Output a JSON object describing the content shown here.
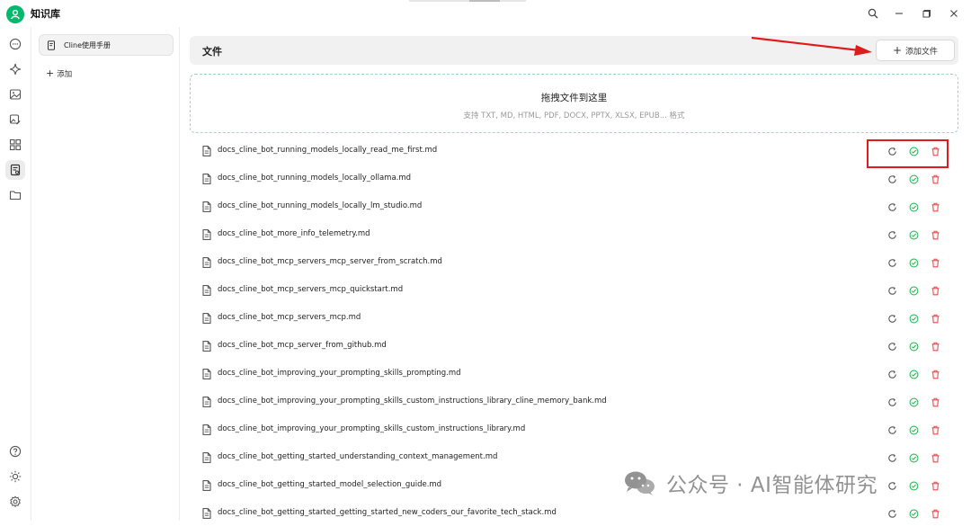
{
  "app": {
    "title": "知识库"
  },
  "knowledge_bases": {
    "items": [
      {
        "label": "Cline使用手册"
      }
    ],
    "add_label": "添加"
  },
  "files": {
    "title": "文件",
    "add_button_label": "添加文件",
    "dropzone_title": "拖拽文件到这里",
    "dropzone_subtitle": "支持 TXT, MD, HTML, PDF, DOCX, PPTX, XLSX, EPUB... 格式",
    "items": [
      {
        "name": "docs_cline_bot_running_models_locally_read_me_first.md"
      },
      {
        "name": "docs_cline_bot_running_models_locally_ollama.md"
      },
      {
        "name": "docs_cline_bot_running_models_locally_lm_studio.md"
      },
      {
        "name": "docs_cline_bot_more_info_telemetry.md"
      },
      {
        "name": "docs_cline_bot_mcp_servers_mcp_server_from_scratch.md"
      },
      {
        "name": "docs_cline_bot_mcp_servers_mcp_quickstart.md"
      },
      {
        "name": "docs_cline_bot_mcp_servers_mcp.md"
      },
      {
        "name": "docs_cline_bot_mcp_server_from_github.md"
      },
      {
        "name": "docs_cline_bot_improving_your_prompting_skills_prompting.md"
      },
      {
        "name": "docs_cline_bot_improving_your_prompting_skills_custom_instructions_library_cline_memory_bank.md"
      },
      {
        "name": "docs_cline_bot_improving_your_prompting_skills_custom_instructions_library.md"
      },
      {
        "name": "docs_cline_bot_getting_started_understanding_context_management.md"
      },
      {
        "name": "docs_cline_bot_getting_started_model_selection_guide.md"
      },
      {
        "name": "docs_cline_bot_getting_started_getting_started_new_coders_our_favorite_tech_stack.md"
      }
    ]
  },
  "watermark": {
    "text": "公众号 · AI智能体研究"
  },
  "colors": {
    "accent": "#00b96b",
    "success": "#2eb85c",
    "danger": "#f04848",
    "annotation": "#e11a1a"
  },
  "icons": {
    "rail": [
      "chat-icon",
      "sparkle-icon",
      "image-icon",
      "image-edit-icon",
      "apps-grid-icon",
      "knowledge-base-icon",
      "folder-icon",
      "help-icon",
      "theme-icon",
      "settings-icon"
    ],
    "row_actions": [
      "refresh-icon",
      "check-circle-icon",
      "trash-icon"
    ]
  }
}
